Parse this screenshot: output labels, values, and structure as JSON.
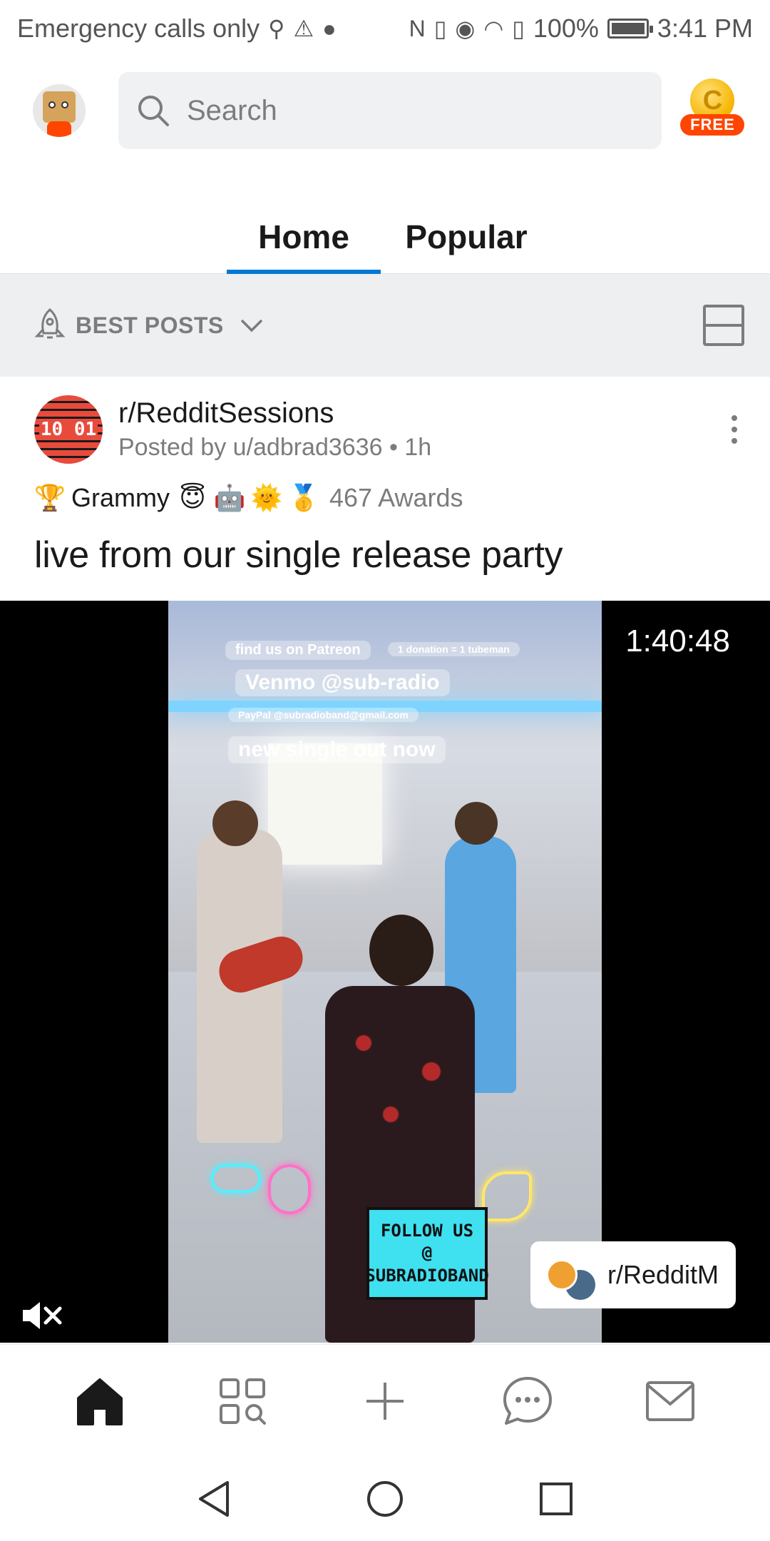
{
  "status_bar": {
    "carrier": "Emergency calls only",
    "battery": "100%",
    "time": "3:41 PM"
  },
  "header": {
    "search_placeholder": "Search",
    "coin_letter": "C",
    "coin_badge": "FREE"
  },
  "tabs": [
    {
      "label": "Home",
      "active": true
    },
    {
      "label": "Popular",
      "active": false
    }
  ],
  "sort": {
    "label": "BEST POSTS"
  },
  "post": {
    "subreddit": "r/RedditSessions",
    "subreddit_icon_text": "10 01",
    "posted_by": "Posted by u/adbrad3636 • 1h",
    "awards_label": "Grammy",
    "awards_count": "467 Awards",
    "title": "live from our single release party",
    "video": {
      "duration": "1:40:48",
      "overlay_patreon": "find us on Patreon",
      "overlay_tube": "1 donation = 1 tubeman",
      "overlay_venmo": "Venmo @sub-radio",
      "overlay_paypal": "PayPal @subradioband@gmail.com",
      "overlay_single": "new single out now",
      "sign_line1": "FOLLOW US",
      "sign_line2": "@",
      "sign_line3": "SUBRADIOBAND",
      "chip_text": "r/RedditM"
    }
  },
  "colors": {
    "accent_blue": "#0079d3",
    "orange": "#ff4500",
    "muted": "#7c7c7c"
  }
}
